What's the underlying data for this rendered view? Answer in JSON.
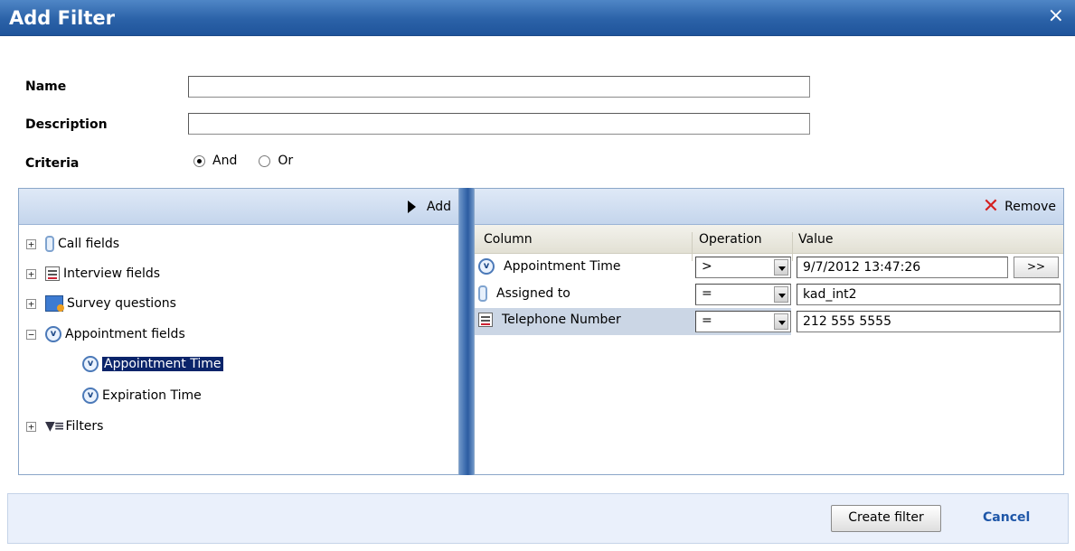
{
  "dialog": {
    "title": "Add Filter",
    "close_glyph": "×"
  },
  "form": {
    "name_label": "Name",
    "name_value": "",
    "description_label": "Description",
    "description_value": "",
    "criteria_label": "Criteria",
    "criteria_options": [
      {
        "label": "And",
        "selected": true
      },
      {
        "label": "Or",
        "selected": false
      }
    ]
  },
  "left_pane": {
    "add_label": "Add",
    "tree": [
      {
        "label": "Call fields",
        "icon": "phone-icon",
        "expanded": false
      },
      {
        "label": "Interview fields",
        "icon": "form-icon",
        "expanded": false
      },
      {
        "label": "Survey questions",
        "icon": "survey-icon",
        "expanded": false
      },
      {
        "label": "Appointment fields",
        "icon": "clock-icon",
        "expanded": true,
        "children": [
          {
            "label": "Appointment Time",
            "icon": "clock-icon",
            "selected": true
          },
          {
            "label": "Expiration Time",
            "icon": "clock-icon",
            "selected": false
          }
        ]
      },
      {
        "label": "Filters",
        "icon": "filter-icon",
        "expanded": false
      }
    ]
  },
  "right_pane": {
    "remove_label": "Remove",
    "columns": [
      "Column",
      "Operation",
      "Value"
    ],
    "rows": [
      {
        "column": "Appointment Time",
        "icon": "clock-icon",
        "operation": ">",
        "value": "9/7/2012 13:47:26",
        "more_label": ">>"
      },
      {
        "column": "Assigned to",
        "icon": "phone-icon",
        "operation": "=",
        "value": "kad_int2"
      },
      {
        "column": "Telephone Number",
        "icon": "form-icon",
        "operation": "=",
        "value": "212 555 5555",
        "selected": true
      }
    ]
  },
  "footer": {
    "create_label": "Create filter",
    "cancel_label": "Cancel"
  }
}
